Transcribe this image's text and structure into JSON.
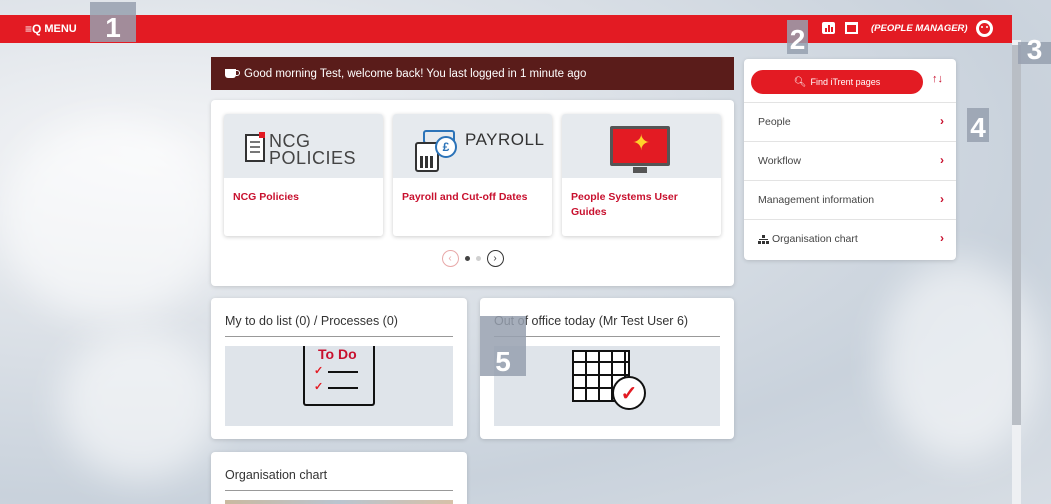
{
  "header": {
    "menu_label": "MENU",
    "menu_glyph": "≡Q",
    "role": "(PEOPLE MANAGER)"
  },
  "markers": [
    "1",
    "2",
    "3",
    "4",
    "5"
  ],
  "welcome": {
    "text": "Good morning Test, welcome back! You last logged in 1 minute ago"
  },
  "carousel": {
    "tiles": [
      {
        "label": "NCG Policies",
        "art_text_1": "NCG",
        "art_text_2": "POLICIES"
      },
      {
        "label": "Payroll and Cut-off Dates",
        "art_text": "PAYROLL",
        "coin": "£"
      },
      {
        "label": "People Systems User Guides"
      }
    ],
    "prev": "‹",
    "next": "›"
  },
  "cards": {
    "todo": {
      "title": "My to do list (0) / Processes (0)",
      "art_text": "To Do"
    },
    "out_of_office": {
      "title": "Out of office today (Mr Test User 6)"
    },
    "org_chart": {
      "title": "Organisation chart"
    }
  },
  "side_nav": {
    "find_label": "Find iTrent pages",
    "sort_glyph": "↑↓",
    "items": [
      {
        "label": "People"
      },
      {
        "label": "Workflow"
      },
      {
        "label": "Management information"
      },
      {
        "label": "Organisation chart"
      }
    ],
    "chevron": "›"
  },
  "colors": {
    "brand_red": "#e31b23",
    "welcome_bg": "#5a1c1a",
    "link_red": "#c8102e"
  }
}
